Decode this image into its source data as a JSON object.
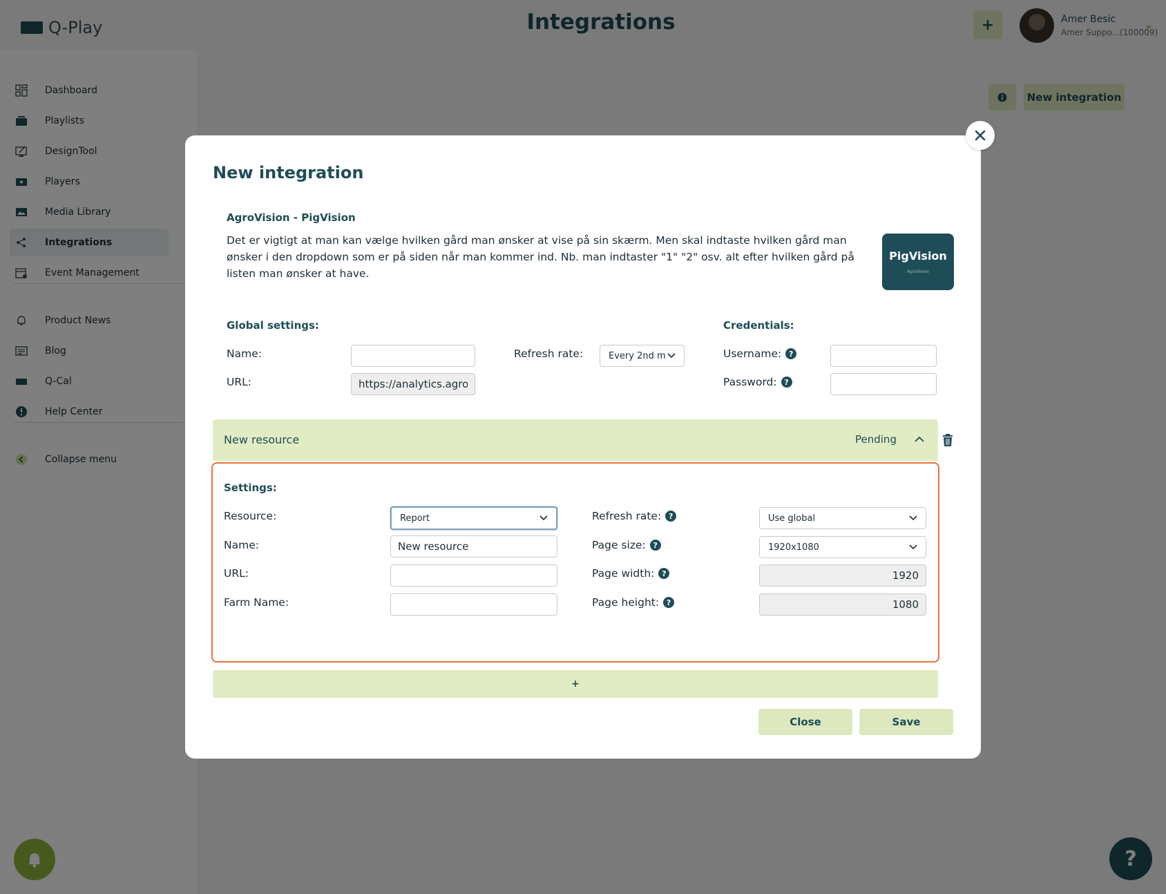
{
  "app": {
    "name": "Q-Play",
    "page_title": "Integrations",
    "add_label": "+",
    "user": {
      "name": "Amer Besic",
      "subtitle": "Amer Suppo...(100009)"
    }
  },
  "sidebar": {
    "items": [
      {
        "label": "Dashboard",
        "icon": "dashboard-icon"
      },
      {
        "label": "Playlists",
        "icon": "playlist-icon"
      },
      {
        "label": "DesignTool",
        "icon": "design-icon"
      },
      {
        "label": "Players",
        "icon": "player-icon"
      },
      {
        "label": "Media Library",
        "icon": "media-icon"
      },
      {
        "label": "Integrations",
        "icon": "share-icon",
        "active": true
      },
      {
        "label": "Event Management",
        "icon": "calendar-icon"
      },
      {
        "label": "Product News",
        "icon": "bell-icon"
      },
      {
        "label": "Blog",
        "icon": "blog-icon"
      },
      {
        "label": "Q-Cal",
        "icon": "qcal-icon"
      },
      {
        "label": "Help Center",
        "icon": "alert-icon"
      },
      {
        "label": "Collapse menu",
        "icon": "chevron-left-icon"
      }
    ]
  },
  "main": {
    "new_integration_label": "New integration"
  },
  "modal": {
    "title": "New integration",
    "integration_name": "AgroVision - PigVision",
    "description": "Det er vigtigt at man kan vælge hvilken gård man ønsker at vise på sin skærm. Men skal indtaste hvilken gård man ønsker i den dropdown som er på siden når man kommer ind. Nb. man indtaster \"1\" \"2\" osv. alt efter hvilken gård på listen man ønsker at have.",
    "logo": {
      "title": "PigVision",
      "small": "AgroVision"
    },
    "global": {
      "heading": "Global settings:",
      "name_label": "Name:",
      "name_value": "",
      "url_label": "URL:",
      "url_value": "https://analytics.agrovi",
      "refresh_label": "Refresh rate:",
      "refresh_value": "Every 2nd m"
    },
    "credentials": {
      "heading": "Credentials:",
      "username_label": "Username:",
      "password_label": "Password:"
    },
    "resource": {
      "header_name": "New resource",
      "status": "Pending",
      "settings_heading": "Settings:",
      "resource_label": "Resource:",
      "resource_value": "Report",
      "name_label": "Name:",
      "name_value": "New resource",
      "url_label": "URL:",
      "url_value": "",
      "farm_label": "Farm Name:",
      "farm_value": "",
      "refresh_label": "Refresh rate:",
      "refresh_value": "Use global",
      "page_size_label": "Page size:",
      "page_size_value": "1920x1080",
      "page_width_label": "Page width:",
      "page_width_value": "1920",
      "page_height_label": "Page height:",
      "page_height_value": "1080"
    },
    "add_resource_label": "+",
    "close_label": "Close",
    "save_label": "Save"
  },
  "colors": {
    "brand": "#1f4d57",
    "accent": "#e2ecc4",
    "highlight": "#e8733a",
    "bell": "#8fb33a"
  }
}
